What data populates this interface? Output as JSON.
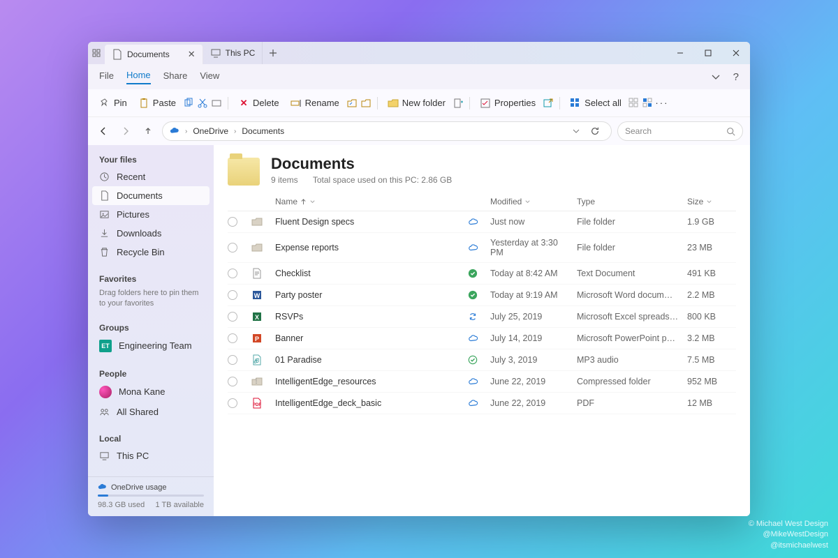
{
  "titlebar": {
    "tabs": [
      {
        "label": "Documents",
        "active": true,
        "icon": "document-icon"
      },
      {
        "label": "This PC",
        "active": false,
        "icon": "pc-icon"
      }
    ]
  },
  "menu": {
    "items": [
      "File",
      "Home",
      "Share",
      "View"
    ],
    "active_index": 1
  },
  "toolbar": {
    "pin": "Pin",
    "paste": "Paste",
    "delete": "Delete",
    "rename": "Rename",
    "new_folder": "New folder",
    "properties": "Properties",
    "select_all": "Select all"
  },
  "address": {
    "root": "OneDrive",
    "path": "Documents"
  },
  "search": {
    "placeholder": "Search"
  },
  "sidebar": {
    "your_files_label": "Your files",
    "your_files": [
      {
        "label": "Recent",
        "icon": "clock-icon"
      },
      {
        "label": "Documents",
        "icon": "document-icon",
        "active": true
      },
      {
        "label": "Pictures",
        "icon": "picture-icon"
      },
      {
        "label": "Downloads",
        "icon": "download-icon"
      },
      {
        "label": "Recycle Bin",
        "icon": "trash-icon"
      }
    ],
    "favorites_label": "Favorites",
    "favorites_hint": "Drag folders here to pin them to your favorites",
    "groups_label": "Groups",
    "groups": [
      {
        "badge": "ET",
        "label": "Engineering Team"
      }
    ],
    "people_label": "People",
    "people": [
      {
        "label": "Mona Kane",
        "kind": "avatar"
      },
      {
        "label": "All Shared",
        "kind": "shared"
      }
    ],
    "local_label": "Local",
    "local": [
      {
        "label": "This PC"
      }
    ],
    "usage": {
      "title": "OneDrive usage",
      "used": "98.3 GB used",
      "available": "1 TB available"
    }
  },
  "main": {
    "title": "Documents",
    "items_label": "9 items",
    "space_label": "Total space used on this PC: 2.86 GB",
    "columns": {
      "name": "Name",
      "modified": "Modified",
      "type": "Type",
      "size": "Size"
    },
    "rows": [
      {
        "icon": "folder",
        "name": "Fluent Design specs",
        "status": "cloud",
        "modified": "Just now",
        "type": "File folder",
        "size": "1.9 GB"
      },
      {
        "icon": "folder",
        "name": "Expense reports",
        "status": "cloud",
        "modified": "Yesterday at 3:30 PM",
        "type": "File folder",
        "size": "23 MB"
      },
      {
        "icon": "txt",
        "name": "Checklist",
        "status": "check",
        "modified": "Today at 8:42 AM",
        "type": "Text Document",
        "size": "491 KB"
      },
      {
        "icon": "word",
        "name": "Party poster",
        "status": "check",
        "modified": "Today at 9:19 AM",
        "type": "Microsoft Word docum…",
        "size": "2.2 MB"
      },
      {
        "icon": "excel",
        "name": "RSVPs",
        "status": "sync",
        "modified": "July 25, 2019",
        "type": "Microsoft Excel spreads…",
        "size": "800 KB"
      },
      {
        "icon": "ppt",
        "name": "Banner",
        "status": "cloud",
        "modified": "July 14, 2019",
        "type": "Microsoft PowerPoint p…",
        "size": "3.2 MB"
      },
      {
        "icon": "audio",
        "name": "01 Paradise",
        "status": "check-outline",
        "modified": "July 3, 2019",
        "type": "MP3 audio",
        "size": "7.5 MB"
      },
      {
        "icon": "zip",
        "name": "IntelligentEdge_resources",
        "status": "cloud",
        "modified": "June 22, 2019",
        "type": "Compressed folder",
        "size": "952 MB"
      },
      {
        "icon": "pdf",
        "name": "IntelligentEdge_deck_basic",
        "status": "cloud",
        "modified": "June 22, 2019",
        "type": "PDF",
        "size": "12 MB"
      }
    ]
  },
  "credit": {
    "l1": "© Michael West Design",
    "l2": "@MikeWestDesign",
    "l3": "@itsmichaelwest"
  }
}
